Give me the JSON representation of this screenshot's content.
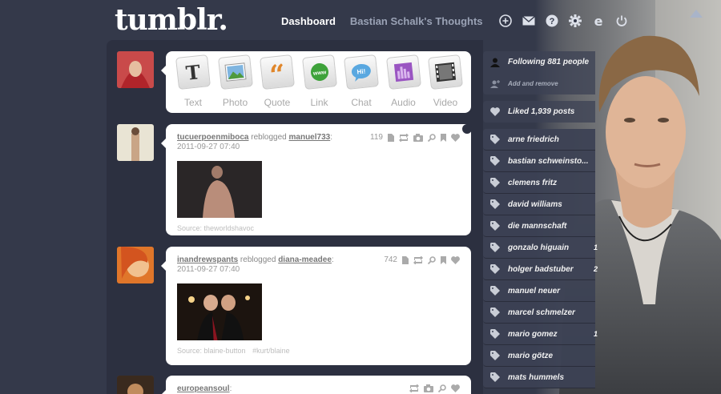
{
  "header": {
    "logo": "tumblr.",
    "nav_dashboard": "Dashboard",
    "nav_blog": "Bastian Schalk's Thoughts",
    "icons": [
      "plus-circle-icon",
      "mail-icon",
      "help-icon",
      "gear-icon",
      "logo-e-icon",
      "power-icon"
    ]
  },
  "new_post": {
    "types": [
      {
        "label": "Text",
        "icon": "text-type-icon"
      },
      {
        "label": "Photo",
        "icon": "photo-type-icon"
      },
      {
        "label": "Quote",
        "icon": "quote-type-icon"
      },
      {
        "label": "Link",
        "icon": "link-type-icon"
      },
      {
        "label": "Chat",
        "icon": "chat-type-icon"
      },
      {
        "label": "Audio",
        "icon": "audio-type-icon"
      },
      {
        "label": "Video",
        "icon": "video-type-icon"
      }
    ]
  },
  "posts": [
    {
      "user": "tucuerpoenmiboca",
      "action": "reblogged",
      "source_user": "manuel733",
      "date": "2011-09-27 07:40",
      "notes": "119",
      "source": "Source: theworldshavoc",
      "tags": ""
    },
    {
      "user": "inandrewspants",
      "action": "reblogged",
      "source_user": "diana-meadee",
      "date": "2011-09-27 07:40",
      "notes": "742",
      "source": "Source: blaine-button",
      "tags": "#kurt/blaine"
    },
    {
      "user": "europeansoul",
      "date": "",
      "notes": ""
    }
  ],
  "sidebar": {
    "following": "Following 881 people",
    "add_remove": "Add and remove",
    "liked": "Liked 1,939 posts",
    "tags": [
      {
        "name": "arne friedrich",
        "count": ""
      },
      {
        "name": "bastian schweinsto...",
        "count": ""
      },
      {
        "name": "clemens fritz",
        "count": ""
      },
      {
        "name": "david williams",
        "count": ""
      },
      {
        "name": "die mannschaft",
        "count": ""
      },
      {
        "name": "gonzalo higuain",
        "count": "1"
      },
      {
        "name": "holger badstuber",
        "count": "2"
      },
      {
        "name": "manuel neuer",
        "count": ""
      },
      {
        "name": "marcel schmelzer",
        "count": ""
      },
      {
        "name": "mario gomez",
        "count": "1"
      },
      {
        "name": "mario götze",
        "count": ""
      },
      {
        "name": "mats hummels",
        "count": ""
      }
    ]
  },
  "colors": {
    "background": "#34394a",
    "panel": "#2c3040",
    "nav_dim": "#9aa2b5"
  }
}
